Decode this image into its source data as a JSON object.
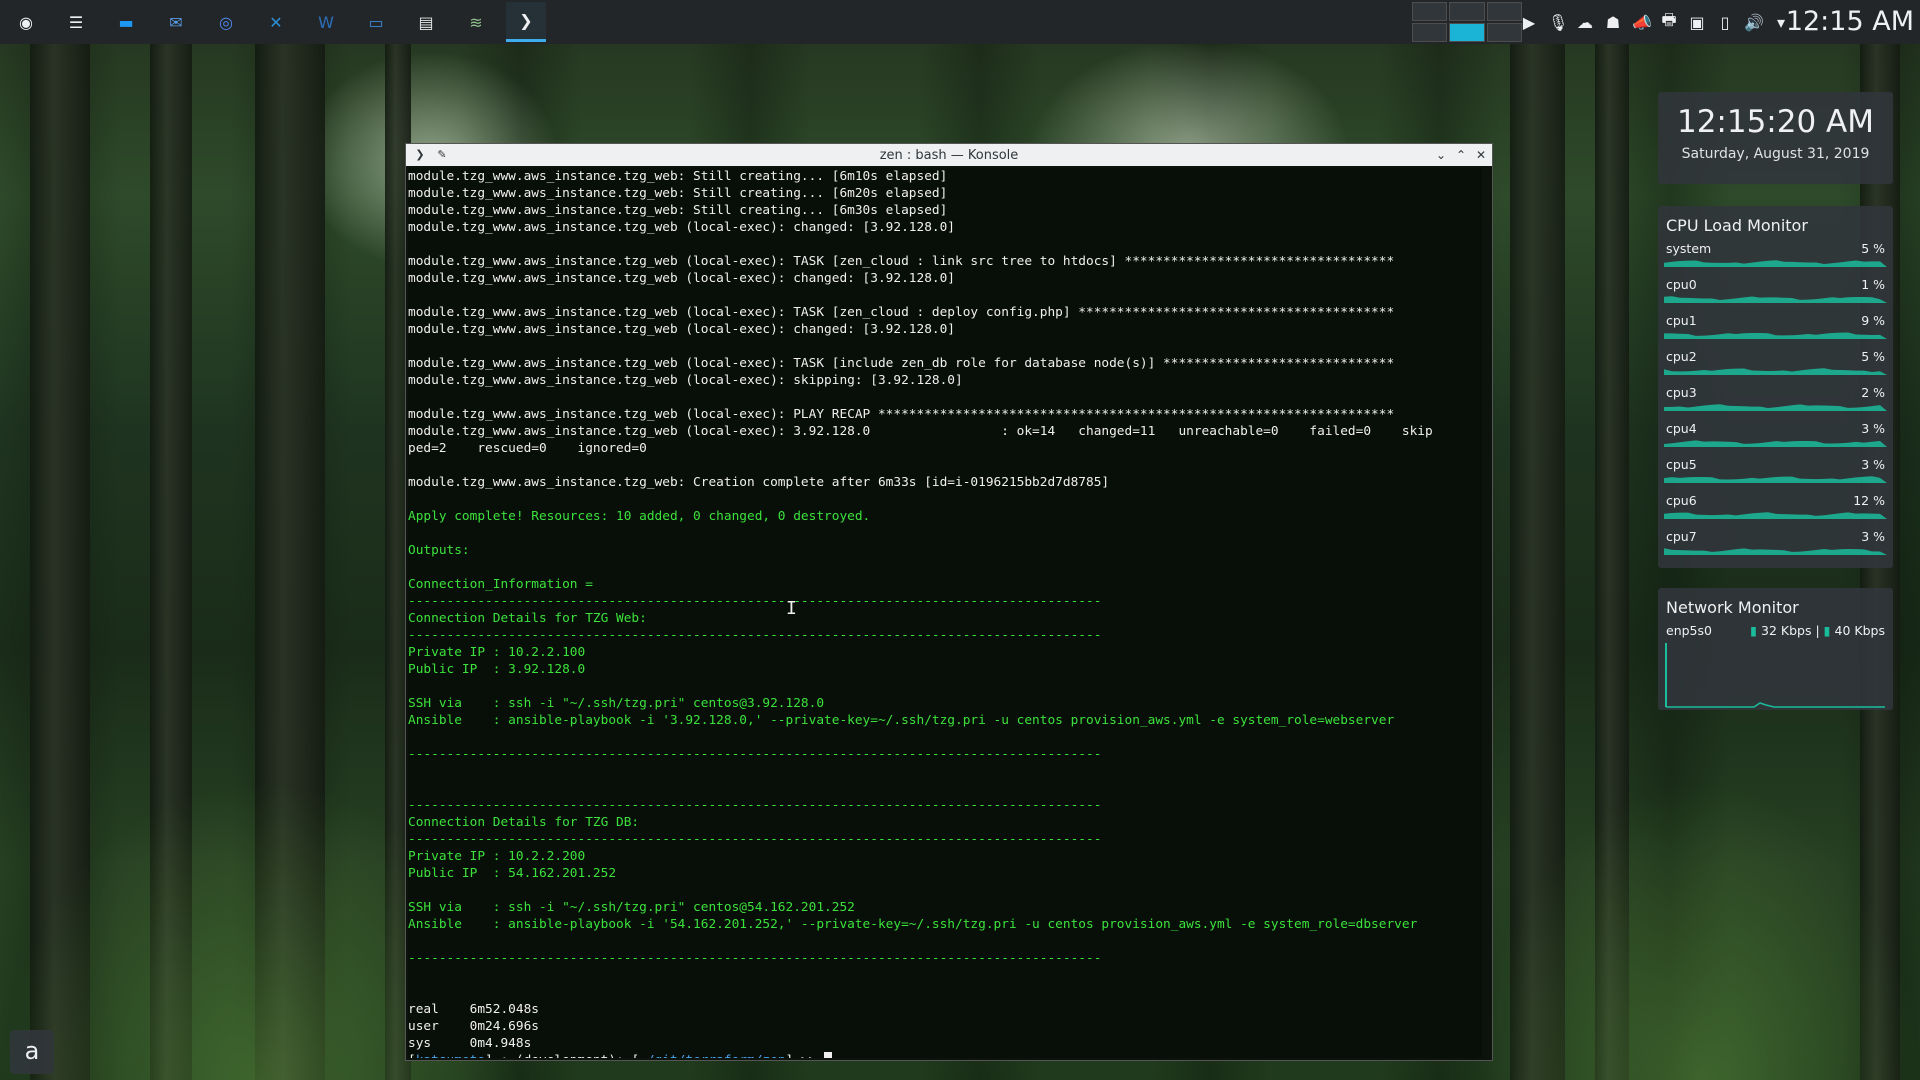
{
  "taskbar": {
    "apps": [
      {
        "name": "app-launcher-icon",
        "glyph": "◉",
        "color": "#eff0f1"
      },
      {
        "name": "settings-sliders-icon",
        "glyph": "☰",
        "color": "#eff0f1"
      },
      {
        "name": "file-manager-icon",
        "glyph": "▬",
        "color": "#1d99f3"
      },
      {
        "name": "thunderbird-icon",
        "glyph": "✉",
        "color": "#5a9de6"
      },
      {
        "name": "chromium-icon",
        "glyph": "◎",
        "color": "#4e8bf0"
      },
      {
        "name": "vscode-icon",
        "glyph": "✕",
        "color": "#2c8fd6"
      },
      {
        "name": "word-processor-icon",
        "glyph": "W",
        "color": "#2a6fba"
      },
      {
        "name": "presentation-icon",
        "glyph": "▭",
        "color": "#3c8ad9"
      },
      {
        "name": "text-editor-icon",
        "glyph": "▤",
        "color": "#e6e6e6"
      },
      {
        "name": "network-app-icon",
        "glyph": "≋",
        "color": "#8fbf8f"
      },
      {
        "name": "konsole-icon",
        "glyph": "❯",
        "color": "#eff0f1"
      }
    ],
    "tray": [
      "▶",
      "🎙",
      "☁",
      "☗",
      "📣",
      "🖶",
      "▣",
      "▯",
      "🔊",
      "▾"
    ],
    "clock": "12:15 AM"
  },
  "window": {
    "title": "zen : bash — Konsole"
  },
  "terminal": {
    "lines": [
      {
        "c": "w",
        "t": "module.tzg_www.aws_instance.tzg_web: Still creating... [6m10s elapsed]"
      },
      {
        "c": "w",
        "t": "module.tzg_www.aws_instance.tzg_web: Still creating... [6m20s elapsed]"
      },
      {
        "c": "w",
        "t": "module.tzg_www.aws_instance.tzg_web: Still creating... [6m30s elapsed]"
      },
      {
        "c": "w",
        "t": "module.tzg_www.aws_instance.tzg_web (local-exec): changed: [3.92.128.0]"
      },
      {
        "c": "w",
        "t": ""
      },
      {
        "c": "w",
        "t": "module.tzg_www.aws_instance.tzg_web (local-exec): TASK [zen_cloud : link src tree to htdocs] ***********************************"
      },
      {
        "c": "w",
        "t": "module.tzg_www.aws_instance.tzg_web (local-exec): changed: [3.92.128.0]"
      },
      {
        "c": "w",
        "t": ""
      },
      {
        "c": "w",
        "t": "module.tzg_www.aws_instance.tzg_web (local-exec): TASK [zen_cloud : deploy config.php] *****************************************"
      },
      {
        "c": "w",
        "t": "module.tzg_www.aws_instance.tzg_web (local-exec): changed: [3.92.128.0]"
      },
      {
        "c": "w",
        "t": ""
      },
      {
        "c": "w",
        "t": "module.tzg_www.aws_instance.tzg_web (local-exec): TASK [include zen_db role for database node(s)] ******************************"
      },
      {
        "c": "w",
        "t": "module.tzg_www.aws_instance.tzg_web (local-exec): skipping: [3.92.128.0]"
      },
      {
        "c": "w",
        "t": ""
      },
      {
        "c": "w",
        "t": "module.tzg_www.aws_instance.tzg_web (local-exec): PLAY RECAP *******************************************************************"
      },
      {
        "c": "w",
        "t": "module.tzg_www.aws_instance.tzg_web (local-exec): 3.92.128.0                 : ok=14   changed=11   unreachable=0    failed=0    skip"
      },
      {
        "c": "w",
        "t": "ped=2    rescued=0    ignored=0"
      },
      {
        "c": "w",
        "t": ""
      },
      {
        "c": "w",
        "t": "module.tzg_www.aws_instance.tzg_web: Creation complete after 6m33s [id=i-0196215bb2d7d8785]"
      },
      {
        "c": "w",
        "t": ""
      },
      {
        "c": "g",
        "t": "Apply complete! Resources: 10 added, 0 changed, 0 destroyed."
      },
      {
        "c": "w",
        "t": ""
      },
      {
        "c": "g",
        "t": "Outputs:"
      },
      {
        "c": "w",
        "t": ""
      },
      {
        "c": "g",
        "t": "Connection_Information ="
      },
      {
        "c": "g",
        "t": "------------------------------------------------------------------------------------------"
      },
      {
        "c": "g",
        "t": "Connection Details for TZG Web:"
      },
      {
        "c": "g",
        "t": "------------------------------------------------------------------------------------------"
      },
      {
        "c": "g",
        "t": "Private IP : 10.2.2.100"
      },
      {
        "c": "g",
        "t": "Public IP  : 3.92.128.0"
      },
      {
        "c": "w",
        "t": ""
      },
      {
        "c": "g",
        "t": "SSH via    : ssh -i \"~/.ssh/tzg.pri\" centos@3.92.128.0"
      },
      {
        "c": "g",
        "t": "Ansible    : ansible-playbook -i '3.92.128.0,' --private-key=~/.ssh/tzg.pri -u centos provision_aws.yml -e system_role=webserver"
      },
      {
        "c": "w",
        "t": ""
      },
      {
        "c": "g",
        "t": "------------------------------------------------------------------------------------------"
      },
      {
        "c": "w",
        "t": ""
      },
      {
        "c": "w",
        "t": ""
      },
      {
        "c": "g",
        "t": "------------------------------------------------------------------------------------------"
      },
      {
        "c": "g",
        "t": "Connection Details for TZG DB:"
      },
      {
        "c": "g",
        "t": "------------------------------------------------------------------------------------------"
      },
      {
        "c": "g",
        "t": "Private IP : 10.2.2.200"
      },
      {
        "c": "g",
        "t": "Public IP  : 54.162.201.252"
      },
      {
        "c": "w",
        "t": ""
      },
      {
        "c": "g",
        "t": "SSH via    : ssh -i \"~/.ssh/tzg.pri\" centos@54.162.201.252"
      },
      {
        "c": "g",
        "t": "Ansible    : ansible-playbook -i '54.162.201.252,' --private-key=~/.ssh/tzg.pri -u centos provision_aws.yml -e system_role=dbserver"
      },
      {
        "c": "w",
        "t": ""
      },
      {
        "c": "g",
        "t": "------------------------------------------------------------------------------------------"
      },
      {
        "c": "w",
        "t": ""
      },
      {
        "c": "w",
        "t": ""
      },
      {
        "c": "w",
        "t": "real    6m52.048s"
      },
      {
        "c": "w",
        "t": "user    0m24.696s"
      },
      {
        "c": "w",
        "t": "sys     0m4.948s"
      }
    ],
    "prompt": {
      "user": "katsumoto",
      "mid": " : (development): [",
      "path": "~/git/terraform/zen",
      "end": "] >> "
    }
  },
  "widgets": {
    "clock": {
      "time": "12:15:20 AM",
      "date": "Saturday, August 31, 2019"
    },
    "cpu": {
      "title": "CPU Load Monitor",
      "rows": [
        {
          "label": "system",
          "pct": "5 %"
        },
        {
          "label": "cpu0",
          "pct": "1 %"
        },
        {
          "label": "cpu1",
          "pct": "9 %"
        },
        {
          "label": "cpu2",
          "pct": "5 %"
        },
        {
          "label": "cpu3",
          "pct": "2 %"
        },
        {
          "label": "cpu4",
          "pct": "3 %"
        },
        {
          "label": "cpu5",
          "pct": "3 %"
        },
        {
          "label": "cpu6",
          "pct": "12 %"
        },
        {
          "label": "cpu7",
          "pct": "3 %"
        }
      ],
      "color": "#1abc9c"
    },
    "network": {
      "title": "Network Monitor",
      "iface": "enp5s0",
      "down": "32 Kbps",
      "sep": "|",
      "up": "40 Kbps"
    }
  },
  "launcher": {
    "glyph": "a"
  }
}
